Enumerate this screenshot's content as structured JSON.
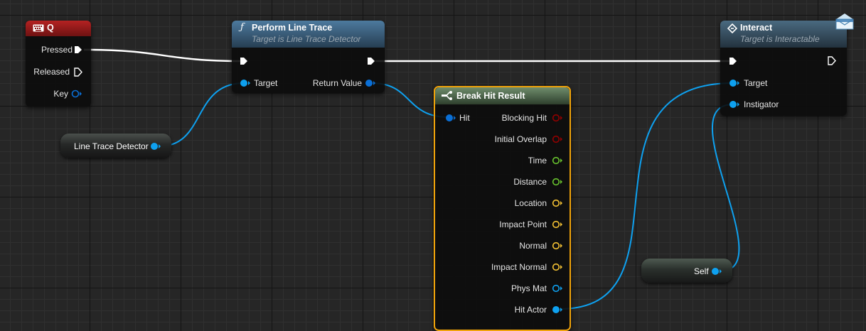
{
  "nodes": {
    "key_q": {
      "title": "Q",
      "icon": "keyboard-icon",
      "header_color": "#9b1b1b",
      "pins": {
        "pressed": "Pressed",
        "released": "Released",
        "key": "Key"
      }
    },
    "line_trace": {
      "title": "Perform Line Trace",
      "subtitle": "Target is Line Trace Detector",
      "icon": "function-icon",
      "header_color": "#3d6a8a",
      "pins": {
        "target": "Target",
        "return_value": "Return Value"
      }
    },
    "break_hit": {
      "title": "Break Hit Result",
      "icon": "struct-break-icon",
      "header_color": "#5b7a59",
      "pins": {
        "hit": "Hit",
        "blocking_hit": "Blocking Hit",
        "initial_overlap": "Initial Overlap",
        "time": "Time",
        "distance": "Distance",
        "location": "Location",
        "impact_point": "Impact Point",
        "normal": "Normal",
        "impact_normal": "Impact Normal",
        "phys_mat": "Phys Mat",
        "hit_actor": "Hit Actor"
      }
    },
    "interact": {
      "title": "Interact",
      "subtitle": "Target is Interactable",
      "icon": "interface-message-icon",
      "header_color": "#3d5d74",
      "pins": {
        "target": "Target",
        "instigator": "Instigator"
      }
    },
    "line_trace_detector_var": {
      "label": "Line Trace Detector"
    },
    "self_var": {
      "label": "Self"
    }
  },
  "colors": {
    "exec": "#ffffff",
    "object": "#0ea1f0",
    "bool": "#940000",
    "float": "#6ac62f",
    "vector": "#f6c334",
    "selected_border": "#f0a30a"
  }
}
